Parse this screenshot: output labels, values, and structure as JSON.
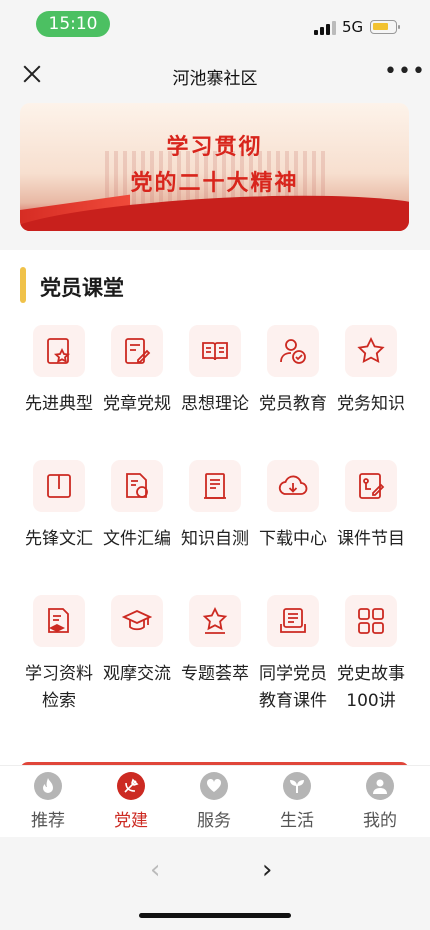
{
  "status": {
    "time": "15:10",
    "network": "5G"
  },
  "nav": {
    "title": "河池寨社区",
    "close_icon": "close-icon",
    "more_label": "•••"
  },
  "banner": {
    "line1": "学习贯彻",
    "line2": "党的二十大精神",
    "accent": "#d8251c"
  },
  "section": {
    "title": "党员课堂",
    "accent": "#f0c24a"
  },
  "grid": [
    {
      "label": "先进典型",
      "icon": "star-document-icon"
    },
    {
      "label": "党章党规",
      "icon": "edit-document-icon"
    },
    {
      "label": "思想理论",
      "icon": "open-book-icon"
    },
    {
      "label": "党员教育",
      "icon": "person-education-icon"
    },
    {
      "label": "党务知识",
      "icon": "star-icon"
    },
    {
      "label": "先锋文汇",
      "icon": "book-icon"
    },
    {
      "label": "文件汇编",
      "icon": "party-file-icon"
    },
    {
      "label": "知识自测",
      "icon": "test-sheet-icon"
    },
    {
      "label": "下载中心",
      "icon": "cloud-download-icon"
    },
    {
      "label": "课件节目",
      "icon": "courseware-icon"
    },
    {
      "label": "学习资料检索",
      "icon": "search-document-icon"
    },
    {
      "label": "观摩交流",
      "icon": "graduation-cap-icon"
    },
    {
      "label": "专题荟萃",
      "icon": "star-badge-icon"
    },
    {
      "label": "同学党员教育课件",
      "icon": "list-document-icon"
    },
    {
      "label": "党史故事100讲",
      "icon": "grid-icon"
    }
  ],
  "tabs": [
    {
      "label": "推荐",
      "icon": "flame-icon",
      "active": false
    },
    {
      "label": "党建",
      "icon": "party-emblem-icon",
      "active": true
    },
    {
      "label": "服务",
      "icon": "heart-hand-icon",
      "active": false
    },
    {
      "label": "生活",
      "icon": "sprout-icon",
      "active": false
    },
    {
      "label": "我的",
      "icon": "user-icon",
      "active": false
    }
  ],
  "browser": {
    "back_label": "‹",
    "forward_label": "›"
  },
  "colors": {
    "primary": "#cc2a22",
    "icon_bg": "#fdf1ef",
    "inactive": "#b5b5b5"
  }
}
